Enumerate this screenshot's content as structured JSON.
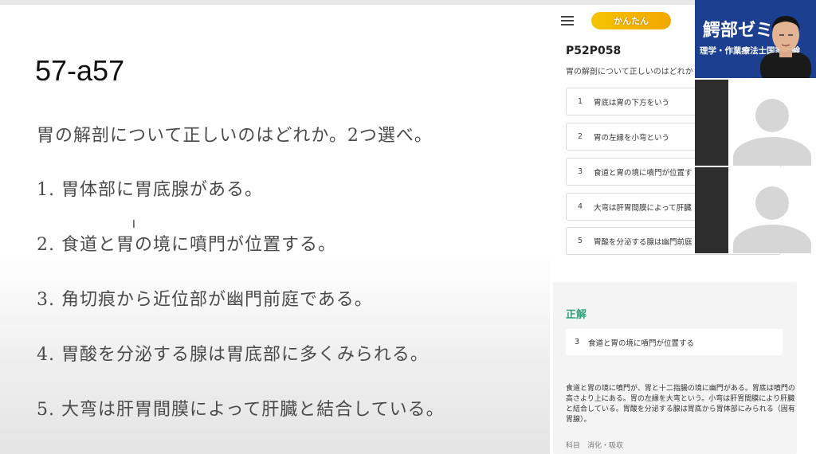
{
  "slide": {
    "title": "57-a57",
    "question": "胃の解剖について正しいのはどれか。2つ選べ。",
    "options": [
      "1. 胃体部に胃底腺がある。",
      "2. 食道と胃の境に噴門が位置する。",
      "3. 角切痕から近位部が幽門前庭である。",
      "4. 胃酸を分泌する腺は胃底部に多くみられる。",
      "5. 大弯は肝胃間膜によって肝臓と結合している。"
    ],
    "cursor": "I"
  },
  "panel": {
    "logo": "かんたん",
    "code": "P52P058",
    "question": "胃の解剖について正しいのはどれか",
    "choices": [
      {
        "num": "1",
        "text": "胃底は胃の下方をいう"
      },
      {
        "num": "2",
        "text": "胃の左縁を小弯という"
      },
      {
        "num": "3",
        "text": "食道と胃の境に噴門が位置す"
      },
      {
        "num": "4",
        "text": "大弯は肝胃間膜によって肝臓"
      },
      {
        "num": "5",
        "text": "胃酸を分泌する腺は幽門前庭"
      }
    ],
    "answer": {
      "heading": "正解",
      "num": "3",
      "text": "食道と胃の境に噴門が位置する",
      "explanation": "食道と胃の境に噴門が、胃と十二指腸の境に幽門がある。胃底は噴門の高さより上にある。胃の左縁を大弯という。小弯は肝胃間膜により肝臓と結合している。胃酸を分泌する腺は胃底から胃体部にみられる（固有胃腺）。",
      "category": "科目　消化・吸収"
    }
  },
  "video": {
    "name": "鰐部ゼミ",
    "subtitle": "理学・作業療法士国家試験"
  },
  "colors": {
    "accent_green": "#2fa37a",
    "video_blue": "#1d3f8f"
  }
}
